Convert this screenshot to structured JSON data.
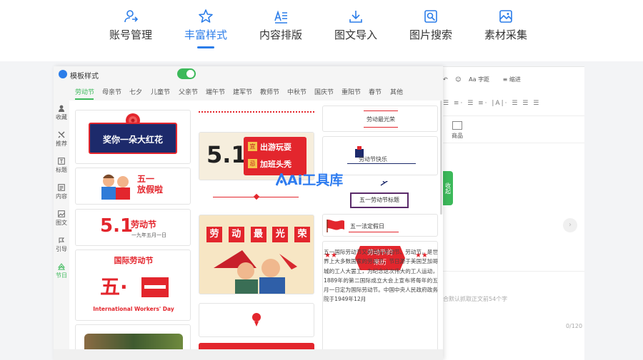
{
  "nav": {
    "items": [
      {
        "label": "账号管理",
        "icon": "user-swap-icon"
      },
      {
        "label": "丰富样式",
        "icon": "sparkle-star-icon",
        "active": true
      },
      {
        "label": "内容排版",
        "icon": "text-align-icon"
      },
      {
        "label": "图文导入",
        "icon": "download-icon"
      },
      {
        "label": "图片搜索",
        "icon": "image-search-icon"
      },
      {
        "label": "素材采集",
        "icon": "image-collect-icon"
      }
    ],
    "accent": "#2b7de9"
  },
  "panel": {
    "title": "模板样式",
    "toggle_on": true,
    "tabs": [
      "劳动节",
      "母亲节",
      "七夕",
      "儿童节",
      "父亲节",
      "端午节",
      "建军节",
      "教师节",
      "中秋节",
      "国庆节",
      "重阳节",
      "春节",
      "其他"
    ],
    "active_tab": "劳动节",
    "accent": "#3cb95a",
    "sidebar": [
      {
        "label": "收藏",
        "icon": "user-icon"
      },
      {
        "label": "推荐",
        "icon": "tools-icon"
      },
      {
        "label": "标题",
        "icon": "title-icon"
      },
      {
        "label": "内容",
        "icon": "content-icon"
      },
      {
        "label": "图文",
        "icon": "image-icon"
      },
      {
        "label": "引导",
        "icon": "guide-icon"
      },
      {
        "label": "节日",
        "icon": "festival-icon",
        "active": true
      }
    ]
  },
  "templates": {
    "c1": "奖你一朵大红花",
    "c2": "五一\n放假啦",
    "c3_big": "5.1",
    "c3_title": "劳动节",
    "c3_sub": "一九年五月一日",
    "c4_title": "国际劳动节",
    "c4_big": "五·",
    "c4_en": "International Workers' Day",
    "m2_big": "5.1",
    "m2_a": "出游玩耍",
    "m2_b": "加班头秃",
    "m2_ia": "宜",
    "m2_ib": "忌",
    "m4_chars": [
      "劳",
      "动",
      "最",
      "光",
      "荣"
    ],
    "r1": "劳动最光荣",
    "r2": "劳动节快乐",
    "r3": "五一劳动节标题",
    "r4": "五一法定假日",
    "r5_title": "劳动节的\n来历",
    "r5_stars": "★★",
    "article": "五一国际劳动节又称国际劳动节、劳动节，是世界上大多数国家的劳动节。节日源于美国芝加哥城的工人大罢工，为纪念这次伟大的工人运动，1889年的第二国际成立大会上宣布将每年的五月一日定为国际劳动节。中国中央人民政府政务院于1949年12月"
  },
  "editor": {
    "tb1": [
      "字距",
      "缩进"
    ],
    "tb2": "|A|·",
    "goods": "商品",
    "collapse": "收起",
    "hint": "合默认抓取正文前54个字",
    "counter": "0/120"
  },
  "watermark": "Ai工具库"
}
